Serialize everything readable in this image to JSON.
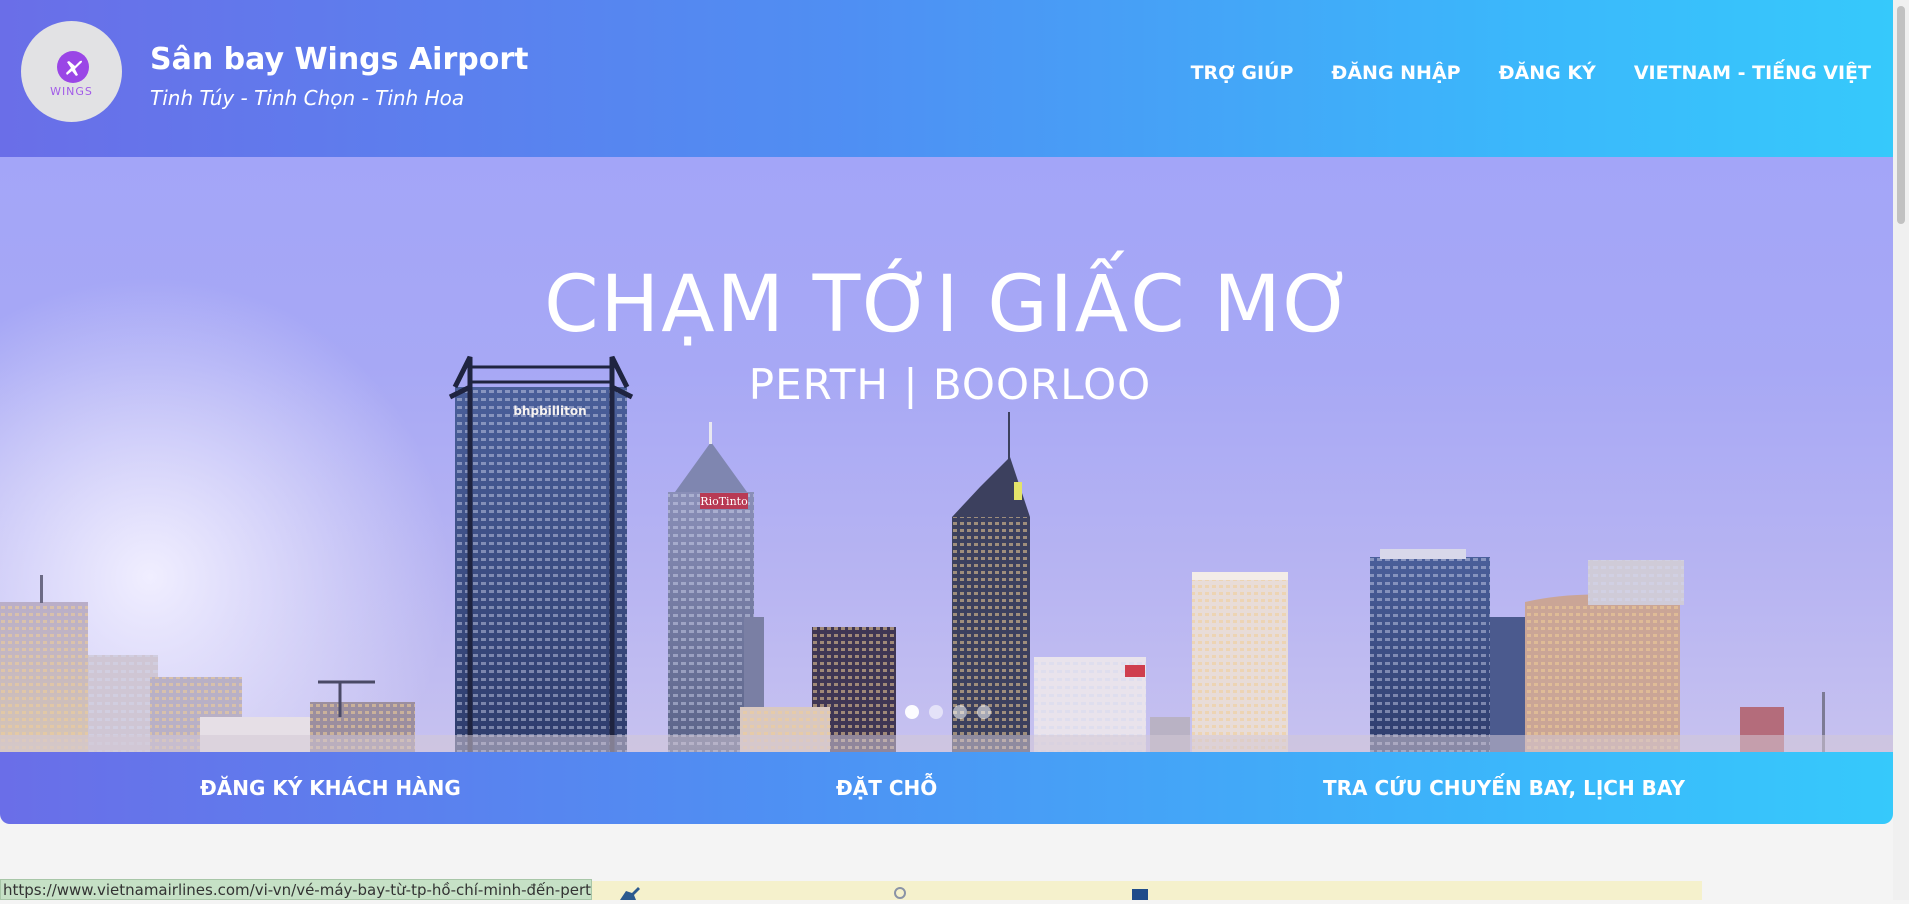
{
  "brand": {
    "logo_text": "WINGS",
    "title": "Sân bay Wings Airport",
    "slogan": "Tinh Túy - Tinh Chọn - Tinh Hoa"
  },
  "top_nav": {
    "help": "TRỢ GIÚP",
    "login": "ĐĂNG NHẬP",
    "register": "ĐĂNG KÝ",
    "language": "VIETNAM - TIẾNG VIỆT"
  },
  "hero": {
    "heading": "CHẠM TỚI GIẤC MƠ",
    "subheading": "PERTH | BOORLOO",
    "building_signs": [
      "bhpbilliton",
      "RioTinto"
    ],
    "slide_count": 4,
    "active_slide": 1
  },
  "bottom_nav": {
    "customer_register": "ĐĂNG KÝ KHÁCH HÀNG",
    "booking": "ĐẶT CHỖ",
    "flight_lookup": "TRA CỨU CHUYẾN BAY, LỊCH BAY"
  },
  "status_bar": {
    "url": "https://www.vietnamairlines.com/vi-vn/vé-máy-bay-từ-tp-hồ-chí-minh-đến-perth"
  },
  "colors": {
    "header_gradient_start": "#6a6ee8",
    "header_gradient_end": "#36c9fb",
    "hero_sky": "#a5a7f6",
    "logo_accent": "#9a46e6"
  }
}
